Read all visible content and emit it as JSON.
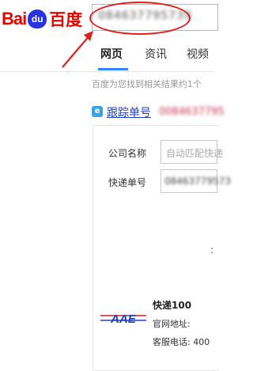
{
  "header": {
    "logo": {
      "bai": "Bai",
      "du": "du",
      "cn": "百度"
    },
    "search": {
      "value": "084637795739"
    }
  },
  "tabs": [
    {
      "label": "网页"
    },
    {
      "label": "资讯"
    },
    {
      "label": "视频"
    }
  ],
  "result_count": "百度为您找到相关结果约1个",
  "result": {
    "icon": "e",
    "title": "跟踪单号",
    "title_number": "0084637795"
  },
  "form": {
    "company_label": "公司名称",
    "company_placeholder": "自动匹配快递",
    "number_label": "快递单号",
    "number_value": "08463779573"
  },
  "colon_mark": ":",
  "provider": {
    "logo_text": "AAE",
    "name": "快递100",
    "site_label": "官网地址:",
    "phone_label": "客服电话: 400"
  },
  "colors": {
    "brand_red": "#e10602",
    "brand_blue": "#2932e1",
    "link_blue": "#2440b3",
    "tab_accent": "#3385ff",
    "annotation_red": "#e02020"
  }
}
